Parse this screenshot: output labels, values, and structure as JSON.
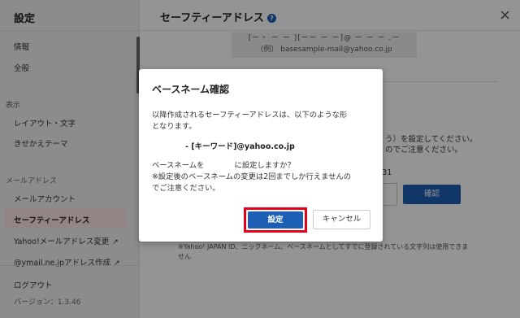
{
  "sidebar": {
    "title": "設定",
    "items": {
      "info": "情報",
      "general": "全般",
      "layout": "レイアウト・文字",
      "theme": "きせかえテーマ",
      "mail_account": "メールアカウント",
      "safety_address": "セーフティーアドレス",
      "yahoo_change": "Yahoo!メールアドレス変更",
      "ymail_create": "@ymail.ne.jpアドレス作成",
      "logout": "ログアウト"
    },
    "sections": {
      "display": "表示",
      "mail_address": "メールアドレス"
    },
    "version": "バージョン：1.3.46"
  },
  "main": {
    "title": "セーフティーアドレス",
    "help_icon": "?",
    "close_icon": "×",
    "example_top": "[ー・ ー ー ][ーー ー ー]@ ー ー ー .ー",
    "example_text": "（例） basesample-mail@yahoo.co.jp",
    "desc_line1": "う）を設定してください。",
    "desc_line2": "のでご注意ください。",
    "date_text": "7/31",
    "confirm_label": "確認",
    "note_line1": "※Yahoo! JAPAN ID、ニックネーム、ベースネームとしてすでに登録されている文字列は使用できま",
    "note_line2": "せん"
  },
  "dialog": {
    "title": "ベースネーム確認",
    "line1": "以降作成されるセーフティーアドレスは、以下のような形",
    "line2": "となります。",
    "address": "- [キーワード]@yahoo.co.jp",
    "question": "ベースネームを　　　　に設定しますか？",
    "note1": "※設定後のベースネームの変更は2回までしか行えませんの",
    "note2": "でご注意ください。",
    "ok_label": "設定",
    "cancel_label": "キャンセル"
  },
  "colors": {
    "accent": "#1e5fb6",
    "highlight_frame": "#e5001a",
    "active_item_bg": "#fde4e6"
  }
}
